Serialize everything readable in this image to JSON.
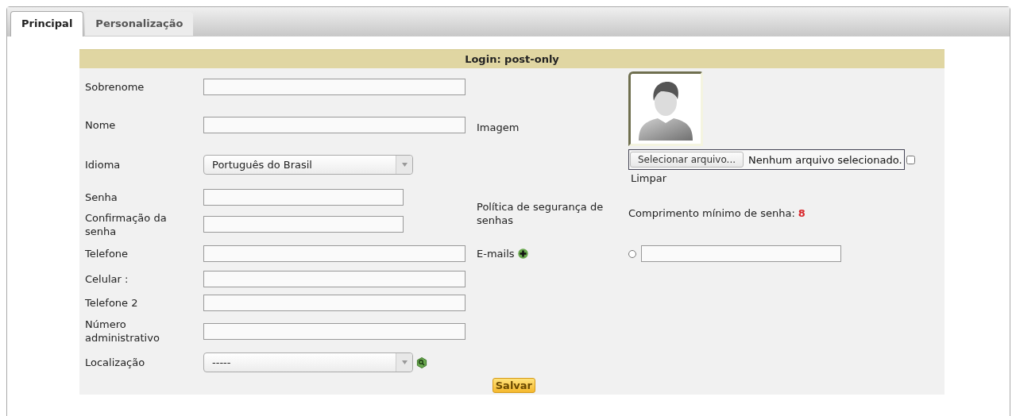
{
  "tabs": [
    {
      "label": "Principal",
      "selected": true
    },
    {
      "label": "Personalização",
      "selected": false
    }
  ],
  "form": {
    "title": "Login: post-only",
    "fields": [
      {
        "label": "Sobrenome",
        "kind": "text"
      },
      {
        "label": "Nome",
        "kind": "text"
      },
      {
        "label": "Idioma",
        "kind": "select",
        "value": "Português do Brasil"
      },
      {
        "label": "Senha",
        "kind": "password"
      },
      {
        "label": "Confirmação da senha",
        "kind": "password"
      },
      {
        "label": "Telefone",
        "kind": "text"
      },
      {
        "label": "Celular :",
        "kind": "text"
      },
      {
        "label": "Telefone 2",
        "kind": "text"
      },
      {
        "label": "Número administrativo",
        "kind": "text"
      },
      {
        "label": "Localização",
        "kind": "lookup",
        "value": "-----"
      }
    ],
    "image": {
      "label": "Imagem",
      "button": "Selecionar arquivo...",
      "file_status": "Nenhum arquivo selecionado.",
      "clear_checked": false,
      "clear_label": "Limpar"
    },
    "password_policy": {
      "label": "Política de segurança de senhas",
      "text": "Comprimento mínimo de senha:",
      "value": "8"
    },
    "emails": {
      "label": "E-mails",
      "entries": [
        {
          "selected": false
        }
      ]
    },
    "save_button": "Salvar"
  }
}
